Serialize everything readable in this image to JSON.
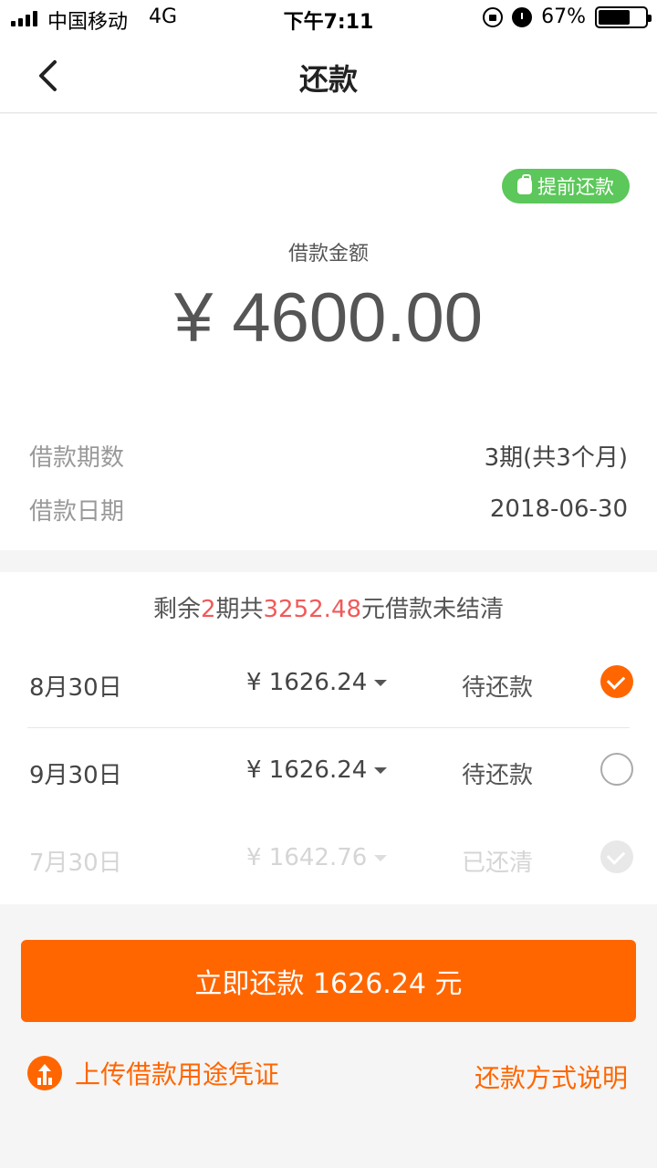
{
  "status_bar": {
    "carrier": "中国移动",
    "network": "4G",
    "time": "下午7:11",
    "battery_text": "67%",
    "battery_level": 0.67,
    "icons": [
      "signal-icon",
      "rotation-lock-icon",
      "alarm-icon",
      "battery-icon"
    ]
  },
  "header": {
    "title": "还款",
    "back_icon": "chevron-left-icon"
  },
  "summary": {
    "prepay_label": "提前还款",
    "prepay_icon": "money-bag-icon",
    "loan_label": "借款金额",
    "loan_amount": "¥ 4600.00",
    "periods_label": "借款期数",
    "periods_value": "3期(共3个月)",
    "date_label": "借款日期",
    "date_value": "2018-06-30"
  },
  "schedule": {
    "remain_prefix": "剩余",
    "remain_count": "2",
    "remain_mid": "期共",
    "remain_amount": "3252.48",
    "remain_suffix": "元借款未结清",
    "rows": [
      {
        "date": "8月30日",
        "amount": "¥ 1626.24",
        "status": "待还款",
        "checked": true
      },
      {
        "date": "9月30日",
        "amount": "¥ 1626.24",
        "status": "待还款",
        "checked": false
      },
      {
        "date": "7月30日",
        "amount": "¥ 1642.76",
        "status": "已还清",
        "checked": true,
        "disabled": true
      }
    ]
  },
  "actions": {
    "pay_button": "立即还款 1626.24 元",
    "upload_label": "上传借款用途凭证",
    "upload_icon": "upload-icon",
    "method_label": "还款方式说明"
  },
  "colors": {
    "accent": "#ff6600",
    "green": "#5cc75a",
    "highlight": "#f05a5a"
  }
}
